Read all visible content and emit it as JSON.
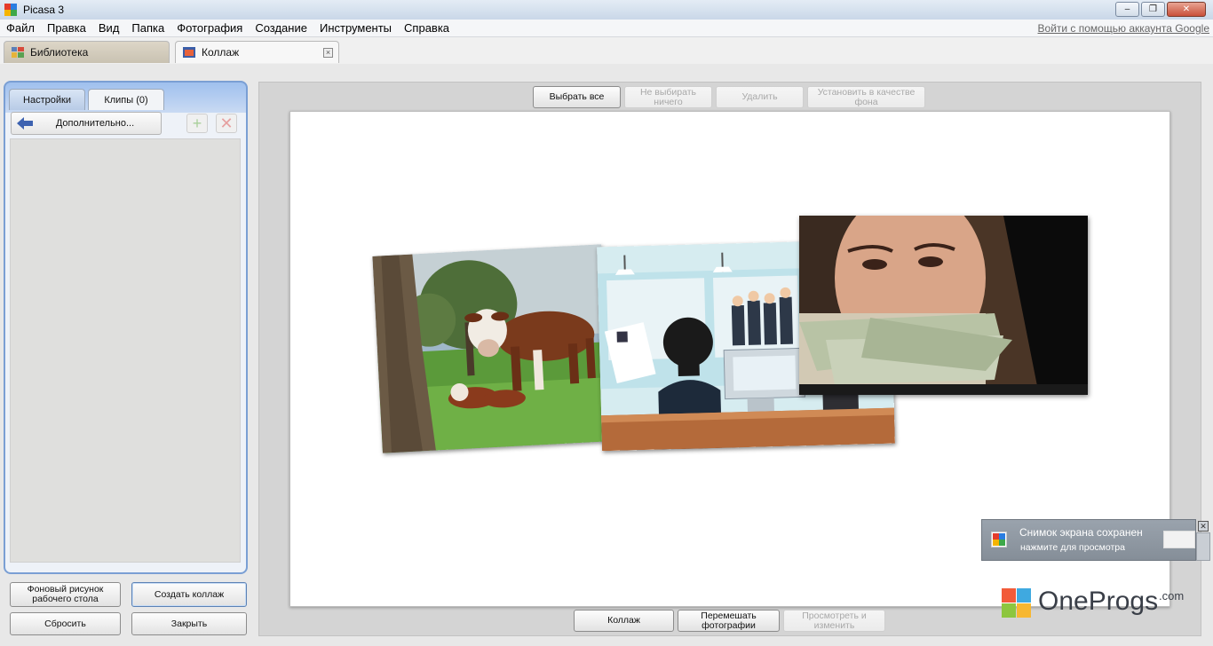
{
  "window": {
    "title": "Picasa 3",
    "minimize": "‒",
    "restore": "❐",
    "close": "✕"
  },
  "menu": [
    "Файл",
    "Правка",
    "Вид",
    "Папка",
    "Фотография",
    "Создание",
    "Инструменты",
    "Справка"
  ],
  "google_link": "Войти с помощью аккаунта Google",
  "tabs": {
    "library": "Библиотека",
    "collage": "Коллаж",
    "close_glyph": "×"
  },
  "left_panel": {
    "tabs": {
      "settings": "Настройки",
      "clips": "Клипы (0)"
    },
    "more_button": "Дополнительно...",
    "add_glyph": "+",
    "remove_glyph": "✕"
  },
  "bottom_left": {
    "desktop_bg": "Фоновый рисунок рабочего стола",
    "create_collage": "Создать коллаж",
    "reset": "Сбросить",
    "close": "Закрыть"
  },
  "toolbar_top": {
    "select_all": "Выбрать все",
    "select_none": "Не выбирать ничего",
    "delete": "Удалить",
    "set_background": "Установить в качестве фона"
  },
  "toolbar_bottom": {
    "collage": "Коллаж",
    "shuffle": "Перемешать фотографии",
    "view_edit": "Просмотреть и изменить"
  },
  "notification": {
    "title": "Снимок экрана сохранен",
    "subtitle": "нажмите для просмотра",
    "close": "✕"
  },
  "watermark": {
    "brand": "OneProgs",
    "suffix": ".com"
  },
  "colors": {
    "accent": "#7a9fd4",
    "panel_top": "#9fc0ee"
  }
}
